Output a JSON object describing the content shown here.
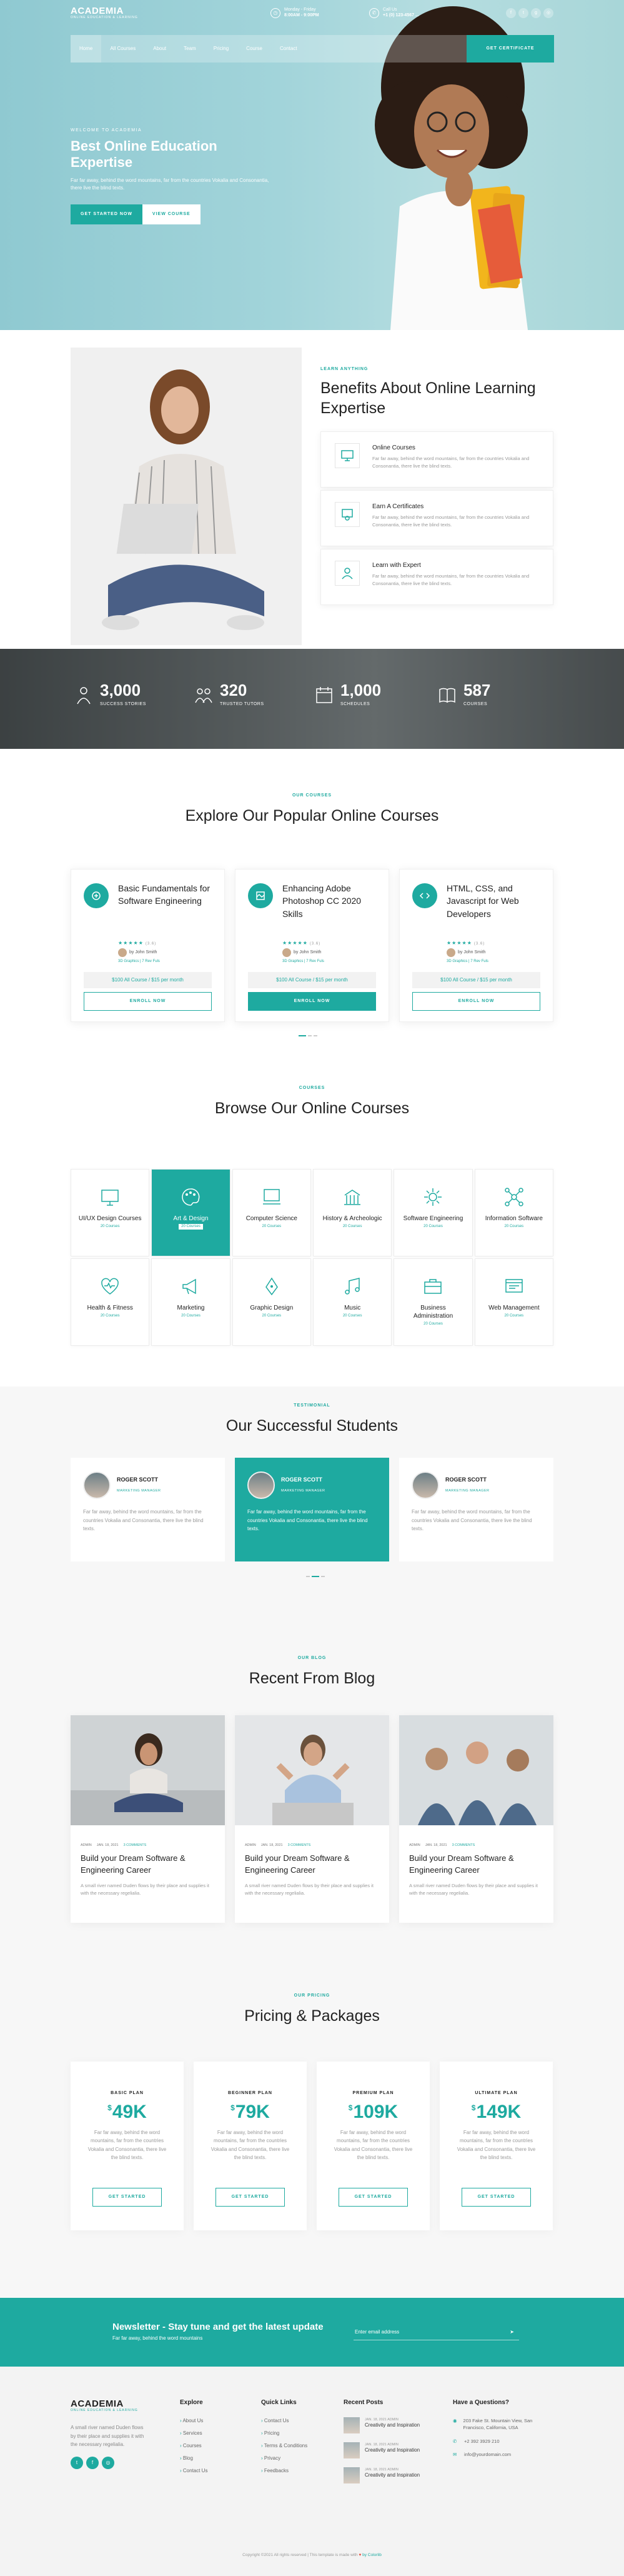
{
  "header": {
    "logo": "ACADEMIA",
    "logo_tag": "ONLINE EDUCATION & LEARNING",
    "hours_line1": "Monday - Friday",
    "hours_line2": "8:00AM - 9:00PM",
    "phone_line1": "Call Us",
    "phone_line2": "+1 (0) 123-4567 ...",
    "nav": [
      "Home",
      "All Courses",
      "About",
      "Team",
      "Pricing",
      "Course",
      "Contact"
    ],
    "cta": "GET CERTIFICATE"
  },
  "hero": {
    "eyebrow": "WELCOME TO ACADEMIA",
    "title": "Best Online Education Expertise",
    "text": "Far far away, behind the word mountains, far from the countries Vokalia and Consonantia, there live the blind texts.",
    "btn_primary": "GET STARTED NOW",
    "btn_secondary": "VIEW COURSE"
  },
  "benefits": {
    "eyebrow": "LEARN ANYTHING",
    "title": "Benefits About Online Learning Expertise",
    "items": [
      {
        "title": "Online Courses",
        "text": "Far far away, behind the word mountains, far from the countries Vokalia and Consonantia, there live the blind texts."
      },
      {
        "title": "Earn A Certificates",
        "text": "Far far away, behind the word mountains, far from the countries Vokalia and Consonantia, there live the blind texts."
      },
      {
        "title": "Learn with Expert",
        "text": "Far far away, behind the word mountains, far from the countries Vokalia and Consonantia, there live the blind texts."
      }
    ]
  },
  "stats": [
    {
      "value": "3,000",
      "label": "SUCCESS STORIES"
    },
    {
      "value": "320",
      "label": "TRUSTED TUTORS"
    },
    {
      "value": "1,000",
      "label": "SCHEDULES"
    },
    {
      "value": "587",
      "label": "COURSES"
    }
  ],
  "popular": {
    "eyebrow": "OUR COURSES",
    "title": "Explore Our Popular Online Courses",
    "courses": [
      {
        "title": "Basic Fundamentals for Software Engineering",
        "rating": "(3.6)",
        "author": "by John Smith",
        "category": "3D Graphics  |  7 Rev Fuls",
        "price": "$100 All Course / $15 per month",
        "button": "ENROLL NOW"
      },
      {
        "title": "Enhancing Adobe Photoshop CC 2020 Skills",
        "rating": "(3.6)",
        "author": "by John Smith",
        "category": "3D Graphics  |  7 Rev Fuls",
        "price": "$100 All Course / $15 per month",
        "button": "ENROLL NOW"
      },
      {
        "title": "HTML, CSS, and Javascript for Web Developers",
        "rating": "(3.6)",
        "author": "by John Smith",
        "category": "3D Graphics  |  7 Rev Fuls",
        "price": "$100 All Course / $15 per month",
        "button": "ENROLL NOW"
      }
    ]
  },
  "browse": {
    "eyebrow": "COURSES",
    "title": "Browse Our Online Courses",
    "categories": [
      {
        "name": "UI/UX Design Courses",
        "count": "20 Courses"
      },
      {
        "name": "Art & Design",
        "count": "20 Courses"
      },
      {
        "name": "Computer Science",
        "count": "20 Courses"
      },
      {
        "name": "History & Archeologic",
        "count": "20 Courses"
      },
      {
        "name": "Software Engineering",
        "count": "20 Courses"
      },
      {
        "name": "Information Software",
        "count": "20 Courses"
      },
      {
        "name": "Health & Fitness",
        "count": "20 Courses"
      },
      {
        "name": "Marketing",
        "count": "20 Courses"
      },
      {
        "name": "Graphic Design",
        "count": "20 Courses"
      },
      {
        "name": "Music",
        "count": "20 Courses"
      },
      {
        "name": "Business Administration",
        "count": "20 Courses"
      },
      {
        "name": "Web Management",
        "count": "20 Courses"
      }
    ]
  },
  "testimonials": {
    "eyebrow": "TESTIMONIAL",
    "title": "Our Successful Students",
    "items": [
      {
        "name": "ROGER SCOTT",
        "role": "MARKETING MANAGER",
        "text": "Far far away, behind the word mountains, far from the countries Vokalia and Consonantia, there live the blind texts."
      },
      {
        "name": "ROGER SCOTT",
        "role": "MARKETING MANAGER",
        "text": "Far far away, behind the word mountains, far from the countries Vokalia and Consonantia, there live the blind texts."
      },
      {
        "name": "ROGER SCOTT",
        "role": "MARKETING MANAGER",
        "text": "Far far away, behind the word mountains, far from the countries Vokalia and Consonantia, there live the blind texts."
      }
    ]
  },
  "blog": {
    "eyebrow": "OUR BLOG",
    "title": "Recent From Blog",
    "posts": [
      {
        "author": "ADMIN",
        "date": "JAN. 18, 2021",
        "comments": "3 COMMENTS",
        "title": "Build your Dream Software & Engineering Career",
        "text": "A small river named Duden flows by their place and supplies it with the necessary regelialia."
      },
      {
        "author": "ADMIN",
        "date": "JAN. 18, 2021",
        "comments": "3 COMMENTS",
        "title": "Build your Dream Software & Engineering Career",
        "text": "A small river named Duden flows by their place and supplies it with the necessary regelialia."
      },
      {
        "author": "ADMIN",
        "date": "JAN. 18, 2021",
        "comments": "3 COMMENTS",
        "title": "Build your Dream Software & Engineering Career",
        "text": "A small river named Duden flows by their place and supplies it with the necessary regelialia."
      }
    ]
  },
  "pricing": {
    "eyebrow": "OUR PRICING",
    "title": "Pricing & Packages",
    "plans": [
      {
        "name": "BASIC PLAN",
        "price": "49K",
        "text": "Far far away, behind the word mountains, far from the countries Vokalia and Consonantia, there live the blind texts.",
        "button": "GET STARTED"
      },
      {
        "name": "BEGINNER PLAN",
        "price": "79K",
        "text": "Far far away, behind the word mountains, far from the countries Vokalia and Consonantia, there live the blind texts.",
        "button": "GET STARTED"
      },
      {
        "name": "PREMIUM PLAN",
        "price": "109K",
        "text": "Far far away, behind the word mountains, far from the countries Vokalia and Consonantia, there live the blind texts.",
        "button": "GET STARTED"
      },
      {
        "name": "ULTIMATE PLAN",
        "price": "149K",
        "text": "Far far away, behind the word mountains, far from the countries Vokalia and Consonantia, there live the blind texts.",
        "button": "GET STARTED"
      }
    ],
    "currency": "$"
  },
  "newsletter": {
    "title": "Newsletter - Stay tune and get the latest update",
    "text": "Far far away, behind the word mountains",
    "placeholder": "Enter email address"
  },
  "footer": {
    "logo": "ACADEMIA",
    "logo_tag": "ONLINE EDUCATION & LEARNING",
    "about": "A small river named Duden flows by their place and supplies it with the necessary regelialia.",
    "explore_title": "Explore",
    "explore": [
      "About Us",
      "Services",
      "Courses",
      "Blog",
      "Contact Us"
    ],
    "quick_title": "Quick Links",
    "quick": [
      "Contact Us",
      "Pricing",
      "Terms & Conditions",
      "Privacy",
      "Feedbacks"
    ],
    "recent_title": "Recent Posts",
    "recent": [
      {
        "date": "JAN. 18, 2021  ADMIN",
        "title": "Creativity and Inspiration"
      },
      {
        "date": "JAN. 18, 2021  ADMIN",
        "title": "Creativity and Inspiration"
      },
      {
        "date": "JAN. 18, 2021  ADMIN",
        "title": "Creativity and Inspiration"
      }
    ],
    "contact_title": "Have a Questions?",
    "address": "203 Fake St. Mountain View, San Francisco, California, USA",
    "phone": "+2 392 3929 210",
    "email": "info@yourdomain.com",
    "copyright_pre": "Copyright ©2021 All rights reserved | This template is made with",
    "copyright_post": "by Colorlib"
  },
  "colors": {
    "accent": "#1eaaa0"
  }
}
